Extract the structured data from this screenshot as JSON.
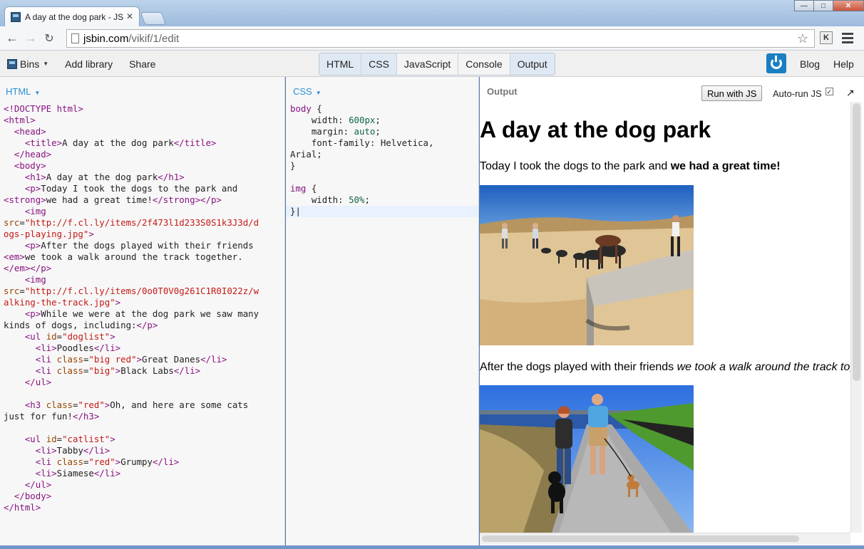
{
  "browser": {
    "tab_title": "A day at the dog park - JS",
    "tab_close": "✕",
    "url_host": "jsbin.com",
    "url_path": "/vikif/1/edit",
    "back_icon": "←",
    "forward_icon": "→",
    "reload_icon": "C",
    "star_icon": "☆",
    "extension_label": "K",
    "win_min": "—",
    "win_max": "□",
    "win_close": "✕"
  },
  "jsbin": {
    "bins_label": "Bins",
    "add_library_label": "Add library",
    "share_label": "Share",
    "panels": [
      "HTML",
      "CSS",
      "JavaScript",
      "Console",
      "Output"
    ],
    "blog_label": "Blog",
    "help_label": "Help"
  },
  "html_panel": {
    "label": "HTML"
  },
  "css_panel": {
    "label": "CSS"
  },
  "output_panel": {
    "label": "Output",
    "run_button": "Run with JS",
    "autorun_label": "Auto-run JS",
    "autorun_checked": "✓",
    "popout_icon": "↗",
    "h1": "A day at the dog park",
    "p1_plain": "Today I took the dogs to the park and ",
    "p1_strong": "we had a great time!",
    "p2_plain": "After the dogs played with their friends ",
    "p2_em": "we took a walk around the track toge"
  },
  "colors": {
    "accent": "#2a8fd6",
    "tag": "#881280",
    "string": "#c41a16",
    "power_button": "#1a7ec2"
  }
}
